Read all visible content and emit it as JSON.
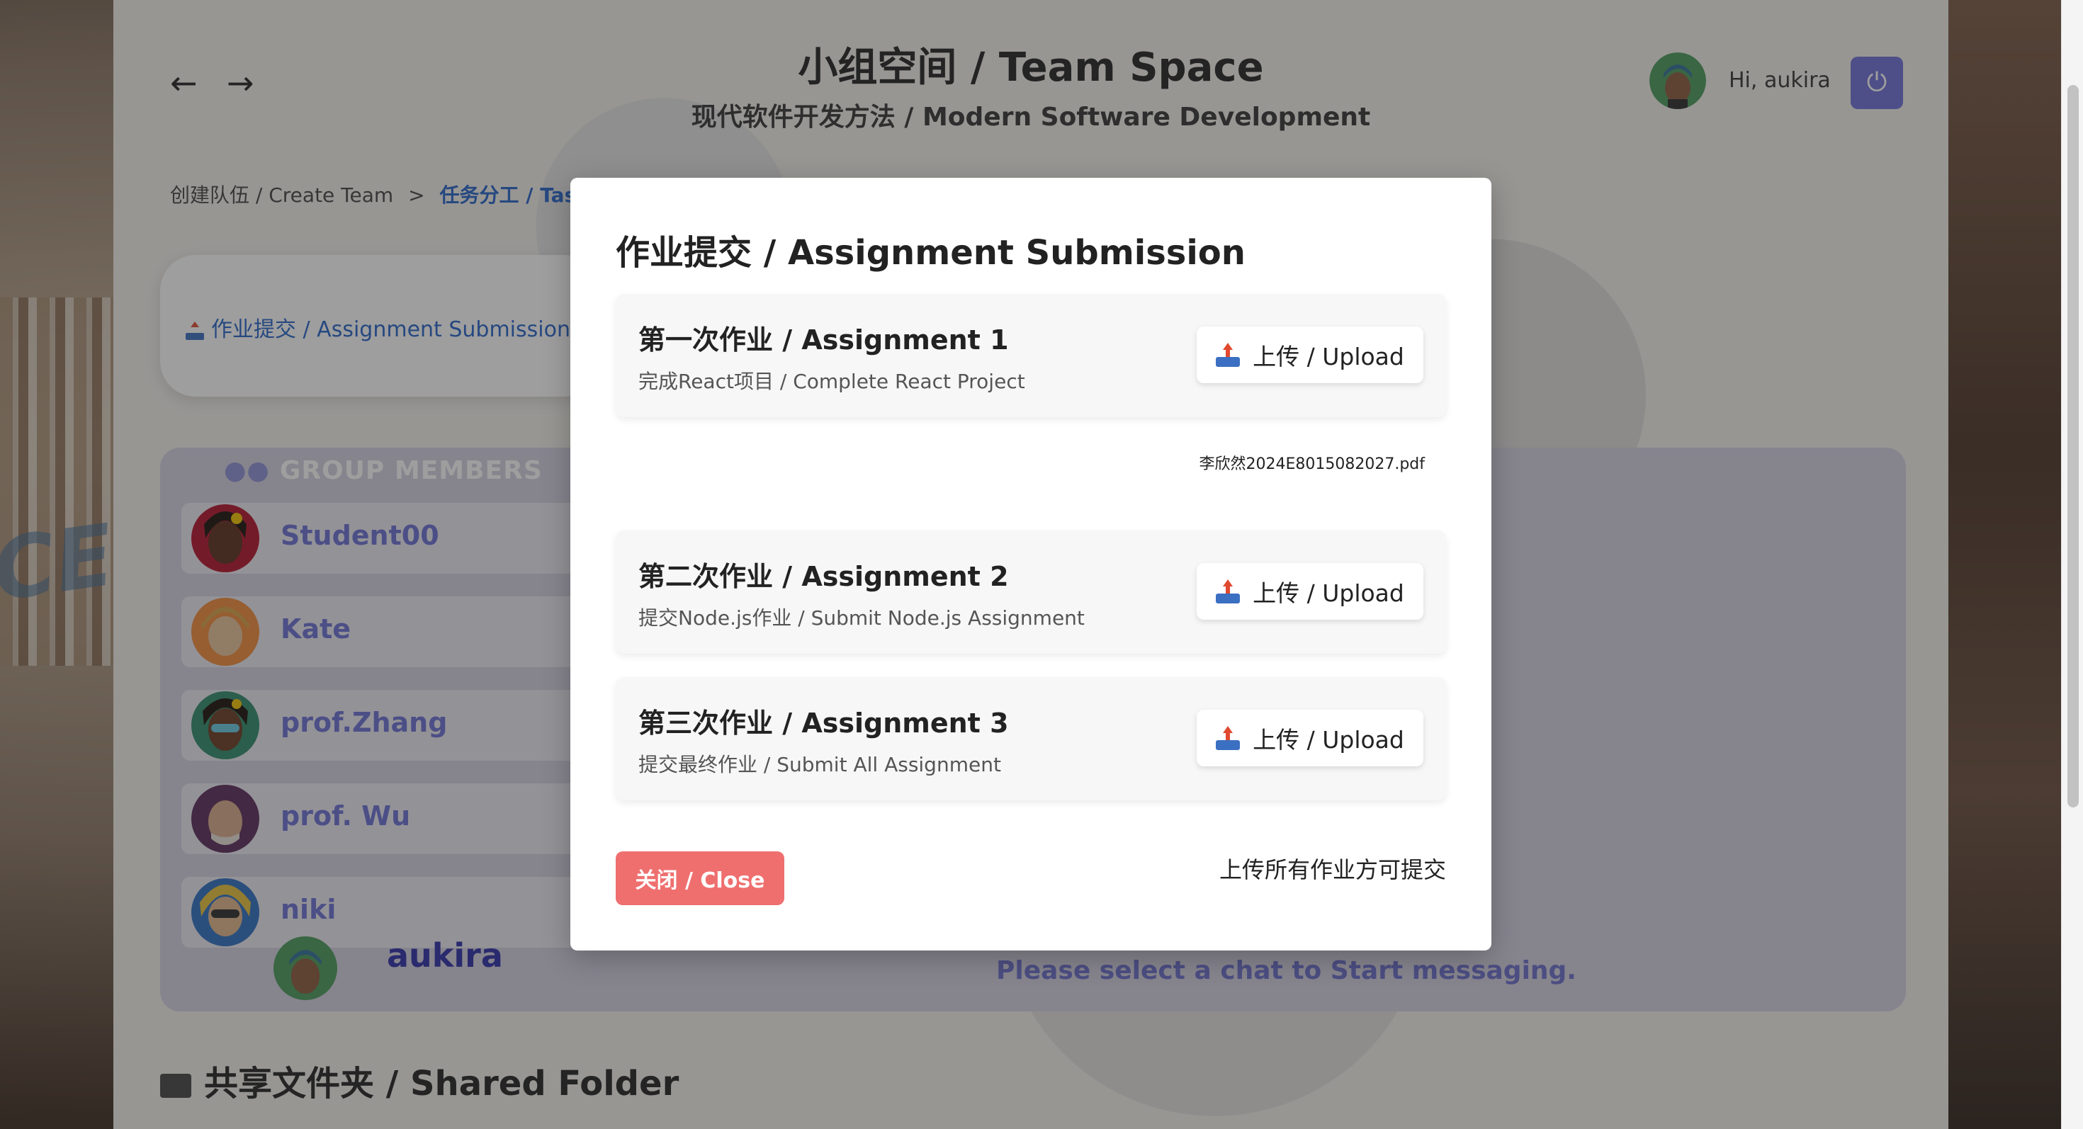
{
  "header": {
    "title": "小组空间 / Team Space",
    "subtitle": "现代软件开发方法 / Modern Software Development",
    "back_icon": "←",
    "forward_icon": "→",
    "greeting": "Hi, aukira",
    "power_icon": "⏻"
  },
  "breadcrumb": {
    "step1": "创建队伍 / Create Team",
    "separator": ">",
    "step2": "任务分工 / Tasl"
  },
  "side_card": {
    "link": "作业提交 / Assignment Submission"
  },
  "members": {
    "heading": "GROUP MEMBERS",
    "list": [
      "Student00",
      "Kate",
      "prof.Zhang",
      "prof. Wu",
      "niki"
    ],
    "self": "aukira"
  },
  "chat": {
    "prompt": "Please select a chat to Start messaging."
  },
  "shared_folder": "共享文件夹 / Shared Folder",
  "modal": {
    "title": "作业提交 / Assignment Submission",
    "assignments": [
      {
        "title": "第一次作业 / Assignment 1",
        "desc": "完成React项目 / Complete React Project",
        "button": "上传 / Upload"
      },
      {
        "title": "第二次作业 / Assignment 2",
        "desc": "提交Node.js作业 / Submit Node.js Assignment",
        "button": "上传 / Upload"
      },
      {
        "title": "第三次作业 / Assignment 3",
        "desc": "提交最终作业 / Submit All Assignment",
        "button": "上传 / Upload"
      }
    ],
    "uploaded_file": "李欣然2024E8015082027.pdf",
    "close_button": "关闭 / Close",
    "hint": "上传所有作业方可提交"
  },
  "colors": {
    "accent": "#6d6fd8",
    "link": "#2563c9",
    "close": "#ef6f6f"
  }
}
